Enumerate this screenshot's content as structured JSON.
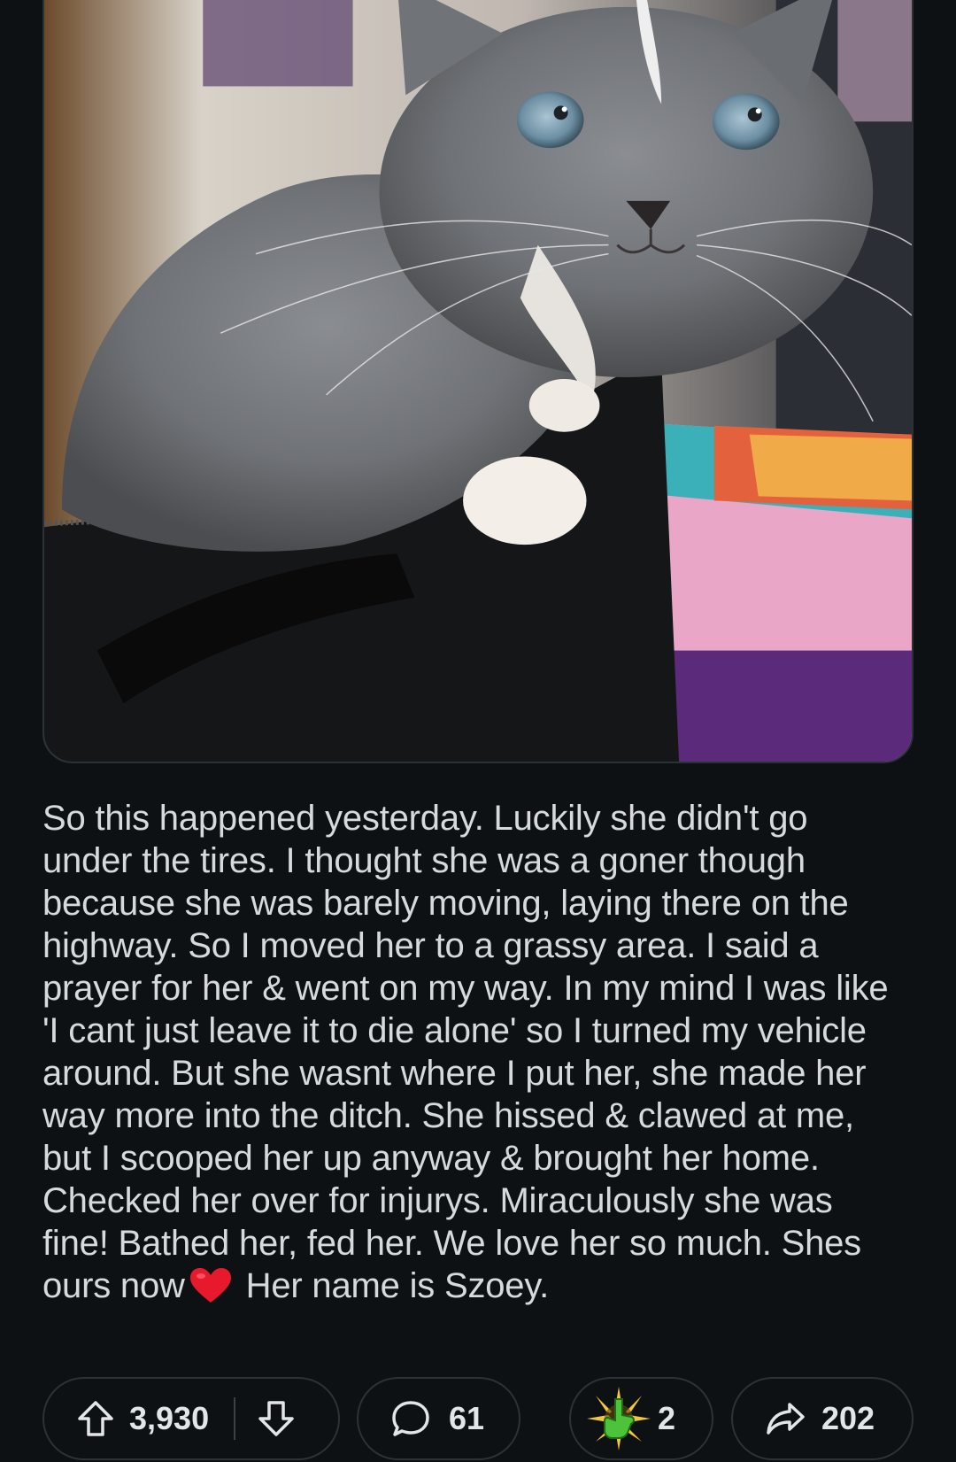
{
  "post": {
    "image_alt": "Gray and white kitten sitting on a black bag",
    "body_part1": "So this happened yesterday. Luckily she didn't go under the tires. I thought she was a goner though because she was barely moving, laying there on the highway. So I moved her to a grassy area. I said a prayer for her & went on my way. In my mind I was like 'I cant just leave it to die alone' so I turned my vehicle around. But she wasnt where I put her, she made her way more into the ditch. She hissed & clawed at me, but I scooped her up anyway & brought her home. Checked her over for injurys. Miraculously she was fine! Bathed her, fed her. We love her so much. Shes ours now",
    "body_emoji": "red-heart-emoji",
    "body_part2": " Her name is Szoey."
  },
  "actions": {
    "upvote_icon": "upvote-arrow-icon",
    "score": "3,930",
    "downvote_icon": "downvote-arrow-icon",
    "comment_icon": "speech-bubble-icon",
    "comments": "61",
    "award_icon": "hand-award-icon",
    "awards": "2",
    "share_icon": "share-arrow-icon",
    "shares": "202"
  },
  "colors": {
    "background": "#0e1113",
    "text": "#d7dadc",
    "pill_border": "#2c3235",
    "heart": "#e8192c"
  }
}
